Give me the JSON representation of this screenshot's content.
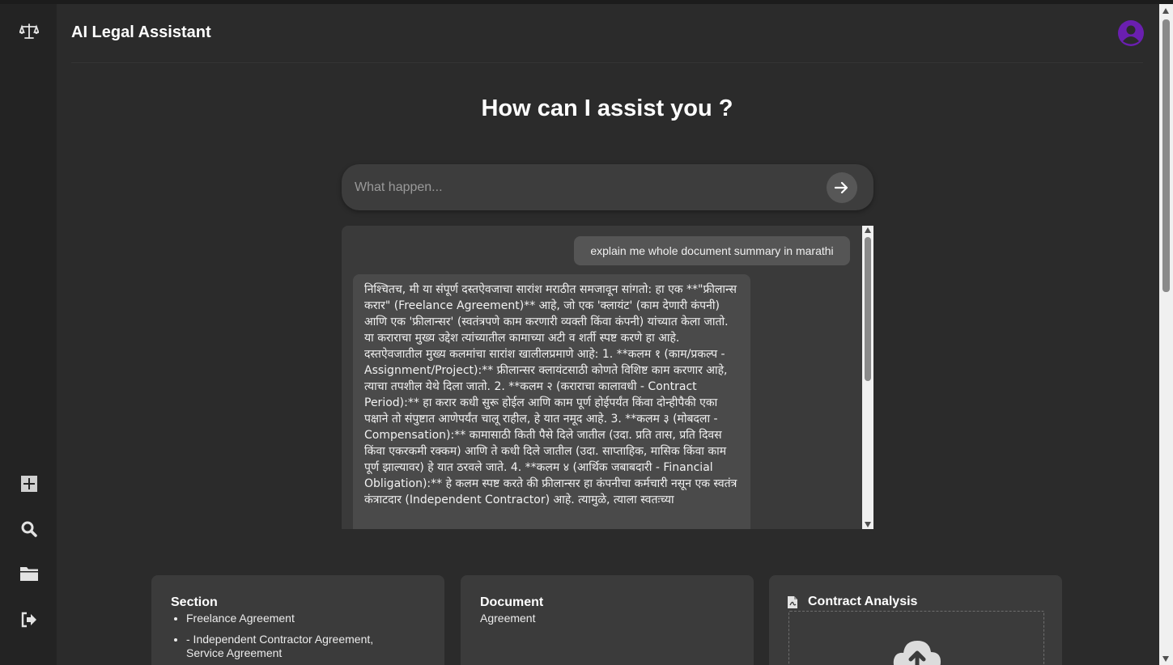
{
  "app": {
    "title": "AI Legal Assistant"
  },
  "sidebar": {
    "items": [
      {
        "icon": "balance-scale-icon"
      },
      {
        "icon": "plus-icon"
      },
      {
        "icon": "search-icon"
      },
      {
        "icon": "folder-icon"
      },
      {
        "icon": "logout-icon"
      }
    ]
  },
  "header": {
    "avatar_icon": "user-avatar-icon",
    "avatar_color": "#6a1fb0"
  },
  "main": {
    "heading": "How can I assist you ?",
    "search": {
      "placeholder": "What happen...",
      "value": "",
      "send_icon": "arrow-right-icon"
    }
  },
  "chat": {
    "messages": [
      {
        "role": "user",
        "text": "explain me whole document summary in marathi"
      },
      {
        "role": "assistant",
        "text": "निश्चितच, मी या संपूर्ण दस्तऐवजाचा सारांश मराठीत समजावून सांगतो: हा एक **\"फ्रीलान्स करार\" (Freelance Agreement)** आहे, जो एक 'क्लायंट' (काम देणारी कंपनी) आणि एक 'फ्रीलान्सर' (स्वतंत्रपणे काम करणारी व्यक्ती किंवा कंपनी) यांच्यात केला जातो. या कराराचा मुख्य उद्देश त्यांच्यातील कामाच्या अटी व शर्ती स्पष्ट करणे हा आहे. दस्तऐवजातील मुख्य कलमांचा सारांश खालीलप्रमाणे आहे: 1. **कलम १ (काम/प्रकल्प - Assignment/Project):** फ्रीलान्सर क्लायंटसाठी कोणते विशिष्ट काम करणार आहे, त्याचा तपशील येथे दिला जातो. 2. **कलम २ (कराराचा कालावधी - Contract Period):** हा करार कधी सुरू होईल आणि काम पूर्ण होईपर्यंत किंवा दोन्हीपैकी एका पक्षाने तो संपुष्टात आणेपर्यंत चालू राहील, हे यात नमूद आहे. 3. **कलम ३ (मोबदला - Compensation):** कामासाठी किती पैसे दिले जातील (उदा. प्रति तास, प्रति दिवस किंवा एकरकमी रक्कम) आणि ते कधी दिले जातील (उदा. साप्ताहिक, मासिक किंवा काम पूर्ण झाल्यावर) हे यात ठरवले जाते. 4. **कलम ४ (आर्थिक जबाबदारी - Financial Obligation):** हे कलम स्पष्ट करते की फ्रीलान्सर हा कंपनीचा कर्मचारी नसून एक स्वतंत्र कंत्राटदार (Independent Contractor) आहे. त्यामुळे, त्याला स्वतःच्या"
      }
    ]
  },
  "cards": {
    "section": {
      "title": "Section",
      "items": [
        "Freelance Agreement",
        "- Independent Contractor Agreement, Service Agreement"
      ]
    },
    "document": {
      "title": "Document",
      "value": "Agreement"
    },
    "contract": {
      "title": "Contract Analysis",
      "icon": "pdf-file-icon",
      "upload_icon": "cloud-upload-icon"
    }
  }
}
